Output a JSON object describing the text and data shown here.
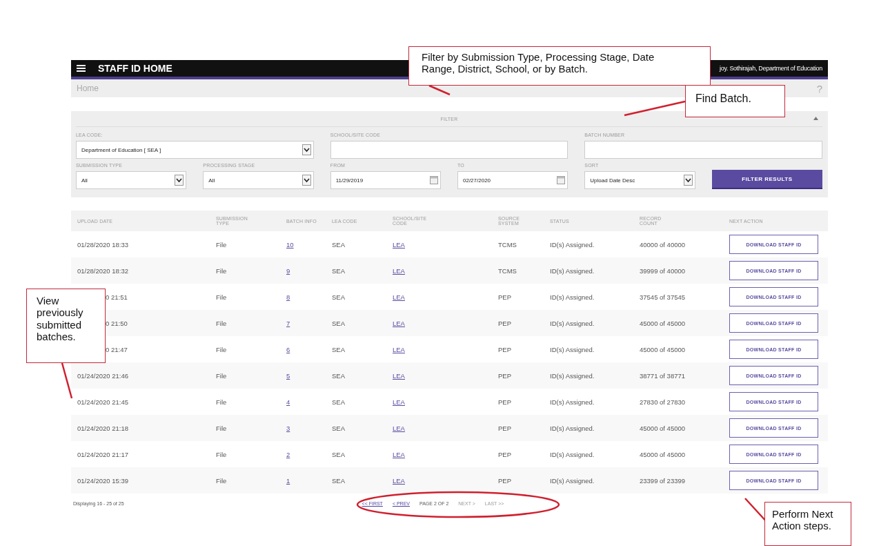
{
  "header": {
    "title": "STAFF ID HOME",
    "user": "joy. Sothirajah, Department of Education"
  },
  "breadcrumb": {
    "label": "Home",
    "help": "?"
  },
  "filter": {
    "title": "FILTER",
    "expanded": true,
    "fields": [
      {
        "kind": "select",
        "label": "LEA CODE:",
        "value": "Department of Education [ SEA ]"
      },
      {
        "kind": "text",
        "label": "SCHOOL/SITE CODE"
      },
      {
        "kind": "text",
        "label": "BATCH NUMBER"
      },
      {
        "kind": "select",
        "label": "SUBMISSION TYPE",
        "value": "All"
      },
      {
        "kind": "select",
        "label": "PROCESSING STAGE",
        "value": "All"
      },
      {
        "kind": "date",
        "label": "FROM",
        "value": "11/29/2019"
      },
      {
        "kind": "date",
        "label": "TO",
        "value": "02/27/2020"
      },
      {
        "kind": "select",
        "label": "SORT",
        "value": "Upload Date Desc"
      },
      {
        "kind": "button",
        "label": "FILTER RESULTS"
      }
    ]
  },
  "table": {
    "columns": [
      "UPLOAD DATE",
      "SUBMISSION TYPE",
      "BATCH INFO",
      "LEA CODE",
      "SCHOOL/SITE CODE",
      "SOURCE SYSTEM",
      "STATUS",
      "RECORD COUNT",
      "NEXT ACTION"
    ],
    "rows": [
      {
        "date": "01/28/2020 18:33",
        "covered": false,
        "type": "File",
        "batch": "10",
        "lea": "SEA",
        "school": "LEA",
        "source": "TCMS",
        "status": "ID(s) Assigned.",
        "count": "40000 of 40000",
        "action": "DOWNLOAD STAFF ID"
      },
      {
        "date": "01/28/2020 18:32",
        "covered": false,
        "type": "File",
        "batch": "9",
        "lea": "SEA",
        "school": "LEA",
        "source": "TCMS",
        "status": "ID(s) Assigned.",
        "count": "39999 of 40000",
        "action": "DOWNLOAD STAFF ID"
      },
      {
        "date": "0 21:51",
        "covered": true,
        "type": "File",
        "batch": "8",
        "lea": "SEA",
        "school": "LEA",
        "source": "PEP",
        "status": "ID(s) Assigned.",
        "count": "37545 of 37545",
        "action": "DOWNLOAD STAFF ID"
      },
      {
        "date": "0 21:50",
        "covered": true,
        "type": "File",
        "batch": "7",
        "lea": "SEA",
        "school": "LEA",
        "source": "PEP",
        "status": "ID(s) Assigned.",
        "count": "45000 of 45000",
        "action": "DOWNLOAD STAFF ID"
      },
      {
        "date": "0 21:47",
        "covered": true,
        "type": "File",
        "batch": "6",
        "lea": "SEA",
        "school": "LEA",
        "source": "PEP",
        "status": "ID(s) Assigned.",
        "count": "45000 of 45000",
        "action": "DOWNLOAD STAFF ID"
      },
      {
        "date": "01/24/2020 21:46",
        "covered": false,
        "type": "File",
        "batch": "5",
        "lea": "SEA",
        "school": "LEA",
        "source": "PEP",
        "status": "ID(s) Assigned.",
        "count": "38771 of 38771",
        "action": "DOWNLOAD STAFF ID"
      },
      {
        "date": "01/24/2020 21:45",
        "covered": false,
        "type": "File",
        "batch": "4",
        "lea": "SEA",
        "school": "LEA",
        "source": "PEP",
        "status": "ID(s) Assigned.",
        "count": "27830 of 27830",
        "action": "DOWNLOAD STAFF ID"
      },
      {
        "date": "01/24/2020 21:18",
        "covered": false,
        "type": "File",
        "batch": "3",
        "lea": "SEA",
        "school": "LEA",
        "source": "PEP",
        "status": "ID(s) Assigned.",
        "count": "45000 of 45000",
        "action": "DOWNLOAD STAFF ID"
      },
      {
        "date": "01/24/2020 21:17",
        "covered": false,
        "type": "File",
        "batch": "2",
        "lea": "SEA",
        "school": "LEA",
        "source": "PEP",
        "status": "ID(s) Assigned.",
        "count": "45000 of 45000",
        "action": "DOWNLOAD STAFF ID"
      },
      {
        "date": "01/24/2020 15:39",
        "covered": false,
        "type": "File",
        "batch": "1",
        "lea": "SEA",
        "school": "LEA",
        "source": "PEP",
        "status": "ID(s) Assigned.",
        "count": "23399 of 23399",
        "action": "DOWNLOAD STAFF ID"
      }
    ]
  },
  "footer": {
    "displaying": "Displaying 16 - 25 of 25",
    "pager": [
      {
        "kind": "link",
        "label": "<< FIRST",
        "disabled": false
      },
      {
        "kind": "link",
        "label": "< PREV",
        "disabled": false
      },
      {
        "kind": "text",
        "label": "PAGE 2 OF 2"
      },
      {
        "kind": "link",
        "label": "NEXT >",
        "disabled": true
      },
      {
        "kind": "link",
        "label": "LAST >>",
        "disabled": true
      }
    ]
  },
  "annotations": [
    {
      "kind": "top",
      "text": "Filter by Submission Type, Processing Stage, Date Range, District, School, or by Batch."
    },
    {
      "kind": "batch",
      "text": "Find Batch."
    },
    {
      "kind": "left",
      "text": "View previously submitted batches."
    },
    {
      "kind": "bottom",
      "text": "Perform Next Action steps."
    }
  ]
}
